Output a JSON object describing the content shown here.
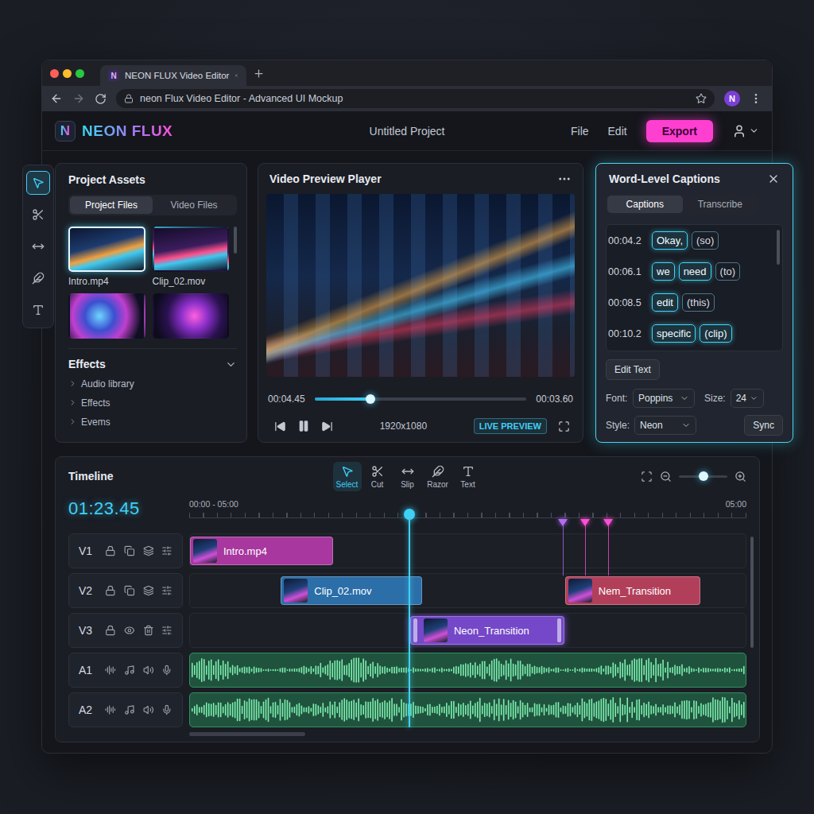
{
  "browser": {
    "tab": {
      "logo": "N",
      "title": "NEON FLUX Video Editor"
    },
    "url": "neon Flux Video Editor - Advanced UI Mockup",
    "avatar": "N"
  },
  "app": {
    "logo": {
      "mark": "N",
      "name": "NEON FLUX"
    },
    "project": "Untitled Project",
    "menu": [
      "File",
      "Edit"
    ],
    "export": "Export"
  },
  "tool_strip": [
    {
      "kind": "select",
      "selected": true
    },
    {
      "kind": "cut",
      "selected": false
    },
    {
      "kind": "slip",
      "selected": false
    },
    {
      "kind": "razor",
      "selected": false
    },
    {
      "kind": "text",
      "selected": false
    }
  ],
  "assets": {
    "title": "Project Assets",
    "tabs": [
      {
        "label": "Project Files",
        "selected": true
      },
      {
        "label": "Video Files",
        "selected": false
      }
    ],
    "files": [
      {
        "name": "Intro.mp4",
        "selected": true
      },
      {
        "name": "Clip_02.mov",
        "selected": false
      },
      {
        "name": null,
        "selected": false
      },
      {
        "name": null,
        "selected": false
      }
    ],
    "effects": {
      "title": "Effects",
      "expanded": true,
      "items": [
        "Audio library",
        "Effects",
        "Evems"
      ]
    }
  },
  "preview": {
    "title": "Video Preview Player",
    "current": "00:04.45",
    "duration": "00:03.60",
    "level": 0.265,
    "resolution": "1920x1080",
    "badge": "LIVE PREVIEW",
    "playing": true
  },
  "captions": {
    "title": "Word-Level Captions",
    "tabs": [
      {
        "label": "Captions",
        "selected": true
      },
      {
        "label": "Transcribe",
        "selected": false
      }
    ],
    "rows": [
      {
        "time": "00:04.2",
        "words": [
          {
            "text": "Okay,",
            "highlighted": true
          },
          {
            "text": "(so)",
            "highlighted": false
          }
        ]
      },
      {
        "time": "00:06.1",
        "words": [
          {
            "text": "we",
            "highlighted": true
          },
          {
            "text": "need",
            "highlighted": true
          },
          {
            "text": "(to)",
            "highlighted": false
          }
        ]
      },
      {
        "time": "00:08.5",
        "words": [
          {
            "text": "edit",
            "highlighted": true
          },
          {
            "text": "(this)",
            "highlighted": false
          }
        ]
      },
      {
        "time": "00:10.2",
        "words": [
          {
            "text": "specific",
            "highlighted": true
          },
          {
            "text": "(clip)",
            "highlighted": true
          }
        ]
      }
    ],
    "edit_button": "Edit Text",
    "font": {
      "label": "Font:",
      "value": "Poppins"
    },
    "size": {
      "label": "Size:",
      "value": "24"
    },
    "style": {
      "label": "Style:",
      "value": "Neon"
    },
    "sync": "Sync"
  },
  "timeline": {
    "title": "Timeline",
    "tools": [
      {
        "label": "Select",
        "kind": "select",
        "selected": true
      },
      {
        "label": "Cut",
        "kind": "cut",
        "selected": false
      },
      {
        "label": "Slip",
        "kind": "slip",
        "selected": false
      },
      {
        "label": "Razor",
        "kind": "razor",
        "selected": false
      },
      {
        "label": "Text",
        "kind": "text",
        "selected": false
      }
    ],
    "zoom": 0.5,
    "timecode": "01:23.45",
    "ruler_start": "00:00 - 05:00",
    "ruler_end": "05:00",
    "playhead": 0.395,
    "markers": [
      {
        "at": 0.67,
        "color": "#b46cf5"
      },
      {
        "at": 0.71,
        "color": "#ff4fd8"
      },
      {
        "at": 0.752,
        "color": "#ff4fd8"
      }
    ],
    "tracks": [
      {
        "name": "V1",
        "kind": "video",
        "clips": [
          {
            "label": "Intro.mp4",
            "start": 0,
            "end": 0.257,
            "color": "#a8379f",
            "selected": false
          }
        ]
      },
      {
        "name": "V2",
        "kind": "video",
        "clips": [
          {
            "label": "Clip_02.mov",
            "start": 0.163,
            "end": 0.417,
            "color": "#2b6ea8",
            "selected": false
          },
          {
            "label": "Nem_Transition",
            "start": 0.673,
            "end": 0.916,
            "color": "#b23f5a",
            "selected": false
          }
        ]
      },
      {
        "name": "V3",
        "kind": "overlay",
        "clips": [
          {
            "label": "Neon_Transition",
            "start": 0.395,
            "end": 0.672,
            "color": "#7448c8",
            "selected": true
          }
        ]
      },
      {
        "name": "A1",
        "kind": "audio",
        "clips": []
      },
      {
        "name": "A2",
        "kind": "audio",
        "clips": []
      }
    ]
  }
}
